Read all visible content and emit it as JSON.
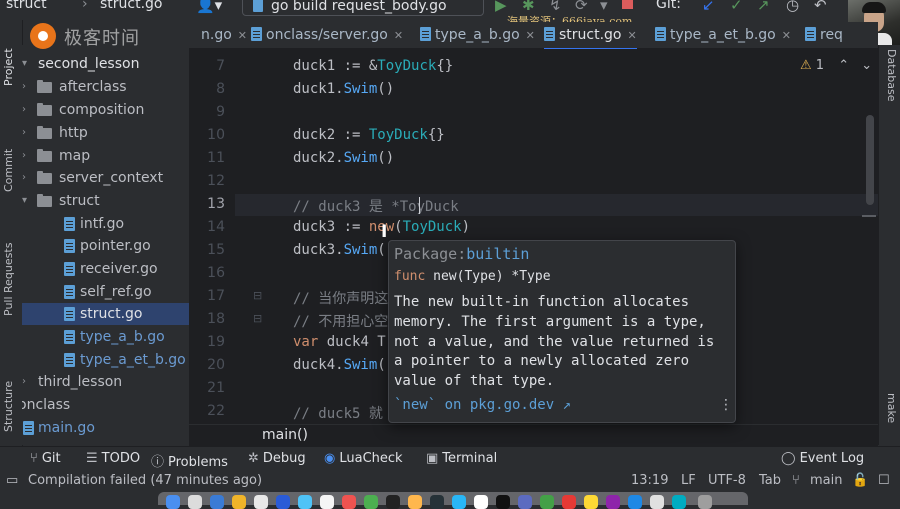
{
  "topbar": {
    "crumb_struct": "struct",
    "crumb_file": "struct.go",
    "run_config": "go build request_body.go",
    "git_label": "Git:",
    "watermark": "海量资源：666java.com"
  },
  "logo": {
    "text": "极客时间"
  },
  "left_stripe": {
    "project": "Project",
    "commit": "Commit",
    "pull_requests": "Pull Requests",
    "structure": "Structure"
  },
  "right_stripe": {
    "database": "Database",
    "make": "make"
  },
  "project_tree": [
    {
      "label": "second_lesson",
      "type": "folder",
      "open": true
    },
    {
      "label": "afterclass",
      "type": "folder",
      "open": false
    },
    {
      "label": "composition",
      "type": "folder",
      "open": false
    },
    {
      "label": "http",
      "type": "folder",
      "open": false
    },
    {
      "label": "map",
      "type": "folder",
      "open": false
    },
    {
      "label": "server_context",
      "type": "folder",
      "open": false
    },
    {
      "label": "struct",
      "type": "folder",
      "open": true
    },
    {
      "label": "intf.go",
      "type": "file"
    },
    {
      "label": "pointer.go",
      "type": "file"
    },
    {
      "label": "receiver.go",
      "type": "file"
    },
    {
      "label": "self_ref.go",
      "type": "file"
    },
    {
      "label": "struct.go",
      "type": "file",
      "selected": true
    },
    {
      "label": "type_a_b.go",
      "type": "file",
      "vcs": true
    },
    {
      "label": "type_a_et_b.go",
      "type": "file",
      "vcs": true
    },
    {
      "label": "third_lesson",
      "type": "folder",
      "open": false
    },
    {
      "label": "onclass",
      "type": "folder",
      "open": true
    },
    {
      "label": "main.go",
      "type": "file"
    }
  ],
  "tabs": [
    {
      "label": "n.go"
    },
    {
      "label": "onclass/server.go"
    },
    {
      "label": "type_a_b.go"
    },
    {
      "label": "struct.go",
      "active": true
    },
    {
      "label": "type_a_et_b.go"
    },
    {
      "label": "req"
    }
  ],
  "editor": {
    "line_numbers": [
      "7",
      "8",
      "9",
      "10",
      "11",
      "12",
      "13",
      "14",
      "15",
      "16",
      "17",
      "18",
      "19",
      "20",
      "21",
      "22"
    ],
    "current_line": "13",
    "inspection_count": "1",
    "lines": {
      "l7_a": "duck1 := &",
      "l7_b": "ToyDuck",
      "l7_c": "{}",
      "l8_a": "duck1.",
      "l8_b": "Swim",
      "l8_c": "()",
      "l10_a": "duck2 := ",
      "l10_b": "ToyDuck",
      "l10_c": "{}",
      "l11_a": "duck2.",
      "l11_b": "Swim",
      "l11_c": "()",
      "l13": "// duck3 是 *ToyDuck",
      "l14_a": "duck3 := ",
      "l14_b": "new",
      "l14_c": "(",
      "l14_d": "ToyDuck",
      "l14_e": ")",
      "l15_a": "duck3.",
      "l15_b": "Swim",
      "l15_c": "(",
      "l17": "// 当你声明这",
      "l18": "// 不用担心空",
      "l19_a": "var",
      "l19_b": " duck4 T",
      "l20_a": "duck4.",
      "l20_b": "Swim",
      "l20_c": "(",
      "l22": "// duck5 就"
    },
    "footer_breadcrumb": "main()"
  },
  "doc_popup": {
    "package_label": "Package:",
    "package_name": "builtin",
    "signature_kw": "func",
    "signature_rest": " new(Type) *Type",
    "description": "The new built-in function allocates memory. The first argument is a type, not a value, and the value returned is a pointer to a newly allocated zero value of that type.",
    "link": "`new` on pkg.go.dev ↗",
    "more": "⋮"
  },
  "tool_windows": [
    {
      "label": "Git",
      "icon": "branch-icon"
    },
    {
      "label": "TODO",
      "icon": "list-icon"
    },
    {
      "label": "Problems",
      "icon": "info-icon"
    },
    {
      "label": "Debug",
      "icon": "bug-icon"
    },
    {
      "label": "LuaCheck",
      "icon": "lua-icon"
    },
    {
      "label": "Terminal",
      "icon": "terminal-icon"
    },
    {
      "label": "Event Log",
      "icon": "bubble-icon"
    }
  ],
  "statusbar": {
    "message": "Compilation failed (47 minutes ago)",
    "position": "13:19",
    "line_sep": "LF",
    "encoding": "UTF-8",
    "indent": "Tab",
    "branch": "main"
  },
  "colors": {
    "accent": "#3574f0",
    "selection": "#2e436e",
    "keyword": "#cf8e6d",
    "function": "#56a8f5",
    "type": "#2aacb8",
    "comment": "#7a7e85"
  }
}
